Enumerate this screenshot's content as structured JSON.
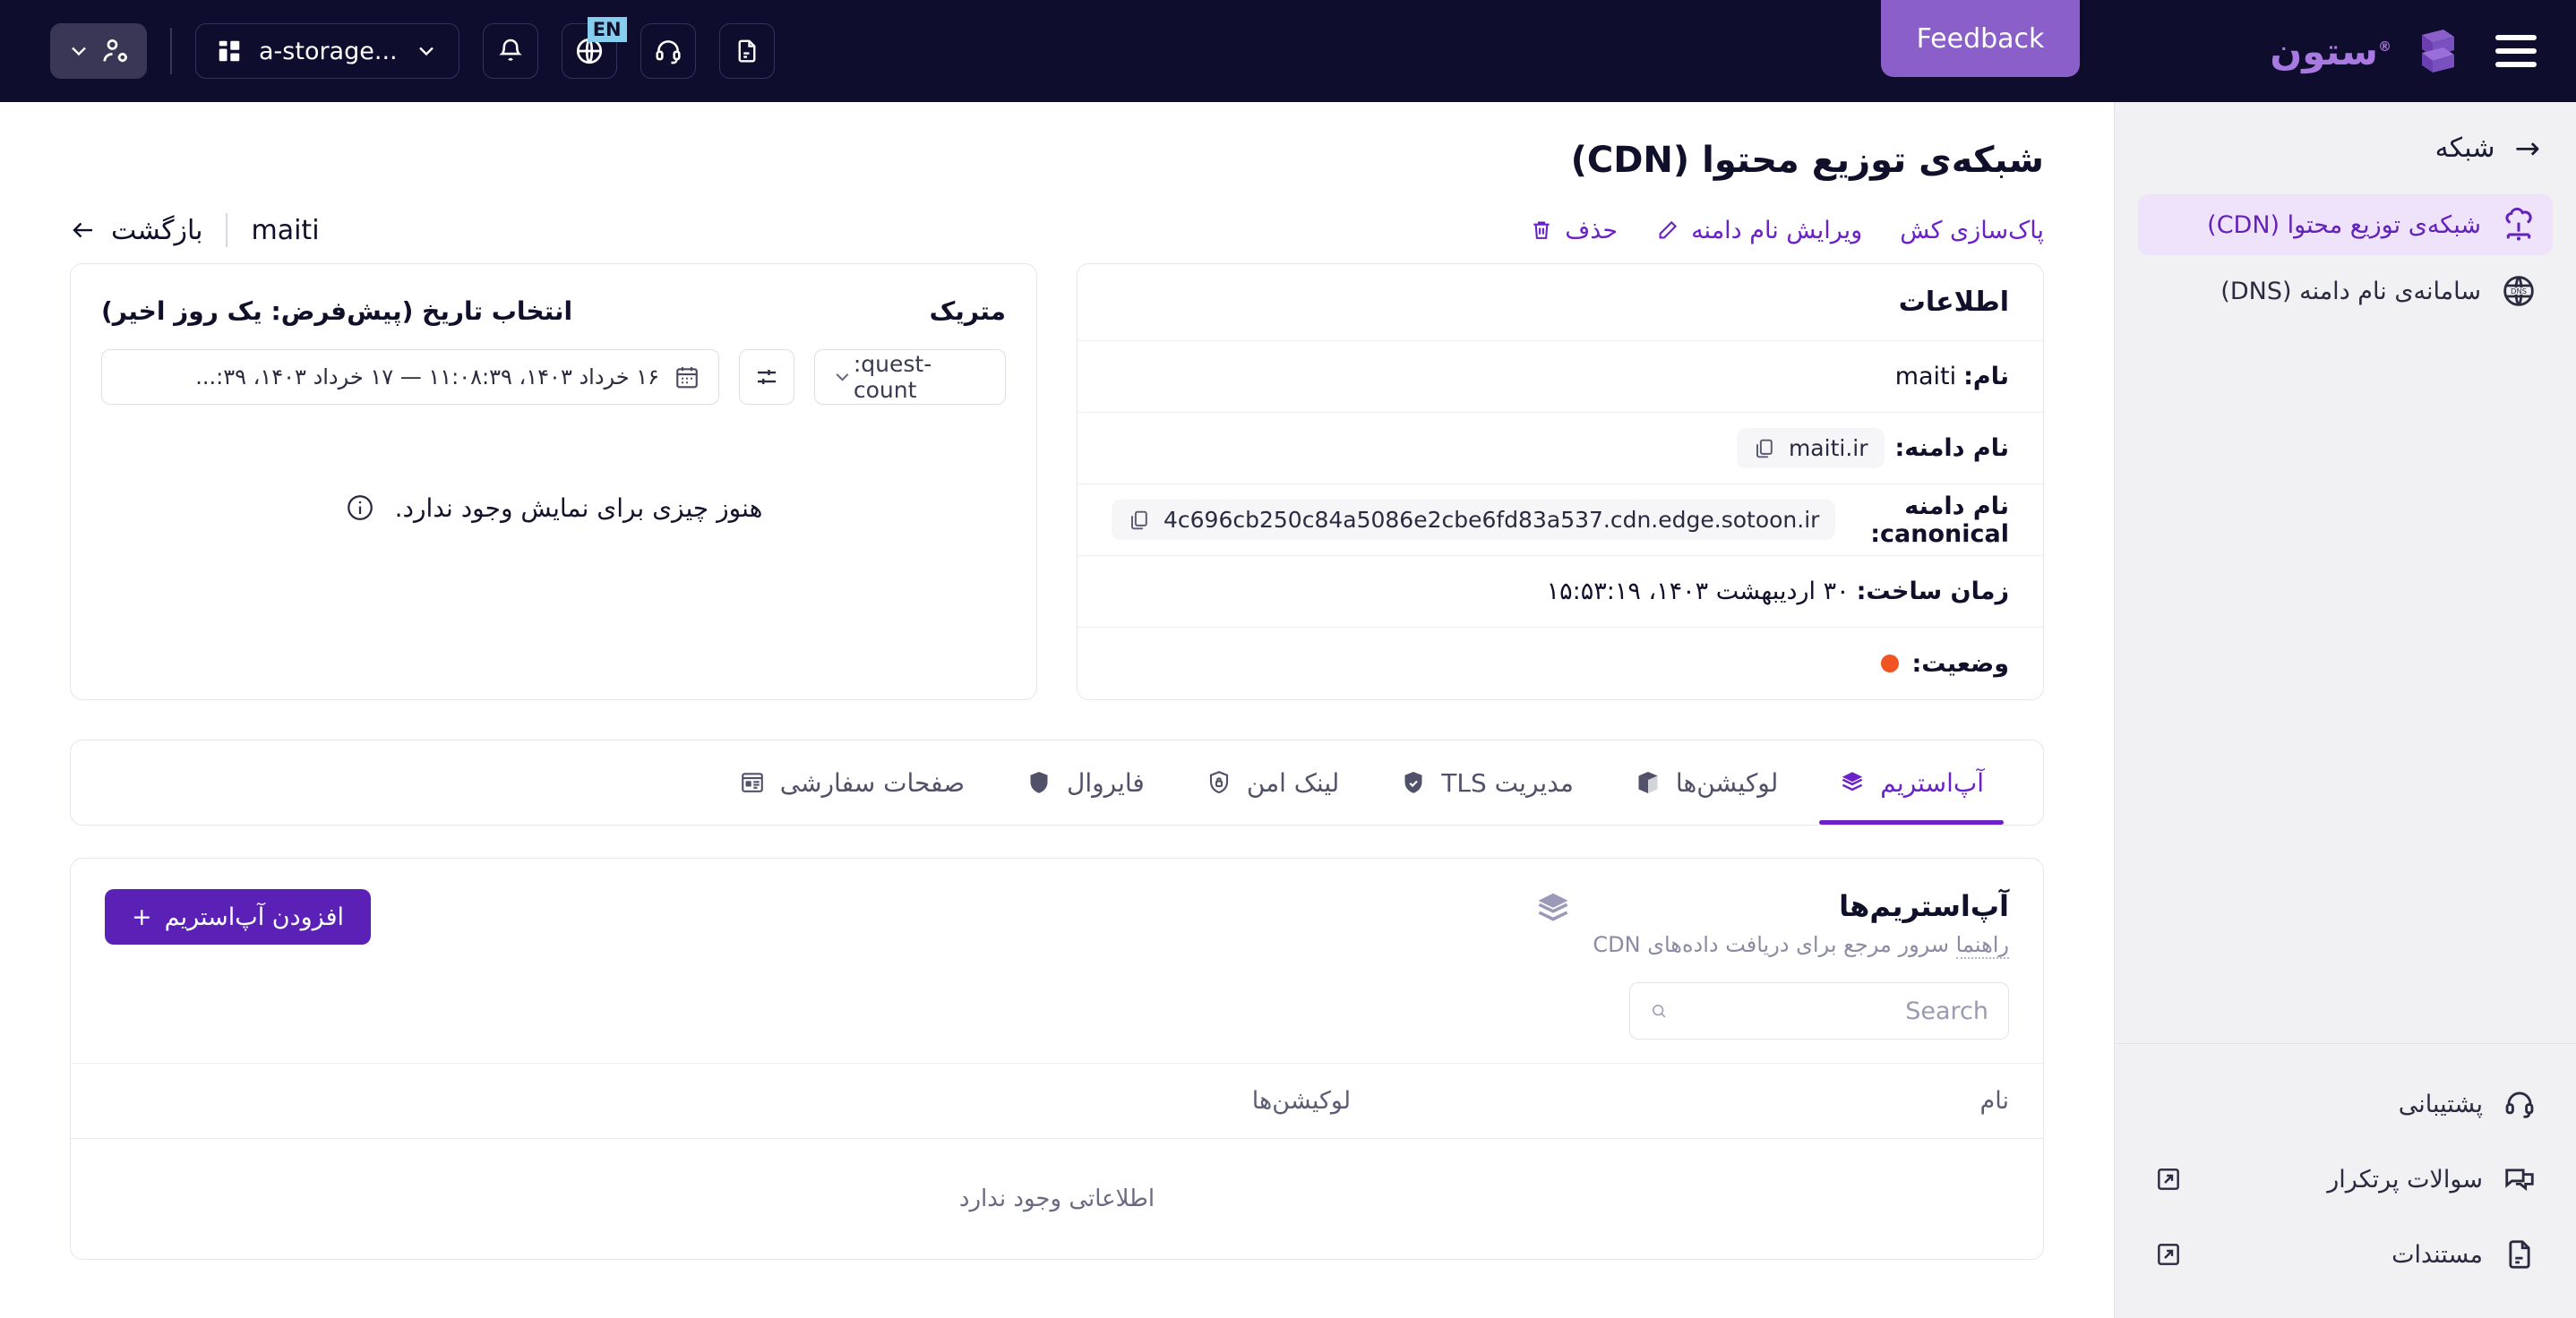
{
  "topbar": {
    "user_button": "user-settings",
    "project_selector": "...a-storage",
    "lang_badge": "EN",
    "feedback_label": "Feedback",
    "brand_name": "ستون",
    "brand_mark": "®"
  },
  "sidebar": {
    "header": "شبکه",
    "items": [
      {
        "label": "شبکه‌ی توزیع محتوا (CDN)",
        "icon": "cdn-cloud-icon",
        "active": true
      },
      {
        "label": "سامانه‌ی نام دامنه (DNS)",
        "icon": "dns-globe-icon",
        "active": false
      }
    ],
    "bottom_items": [
      {
        "label": "پشتیبانی",
        "icon": "headset-icon",
        "external": false
      },
      {
        "label": "سوالات پرتکرار",
        "icon": "chat-icon",
        "external": true
      },
      {
        "label": "مستندات",
        "icon": "document-icon",
        "external": true
      }
    ]
  },
  "page": {
    "title": "شبکه‌ی توزیع محتوا (CDN)",
    "back_label": "بازگشت",
    "resource_name": "maiti",
    "actions": [
      {
        "label": "پاک‌سازی کش",
        "icon": "none"
      },
      {
        "label": "ویرایش نام دامنه",
        "icon": "pencil-icon"
      },
      {
        "label": "حذف",
        "icon": "trash-icon"
      }
    ]
  },
  "info_card": {
    "title": "اطلاعات",
    "rows": [
      {
        "label": "نام:",
        "value": "maiti",
        "type": "text"
      },
      {
        "label": "نام دامنه:",
        "value": "maiti.ir",
        "type": "copy"
      },
      {
        "label": "نام دامنه canonical:",
        "value": "4c696cb250c84a5086e2cbe6fd83a537.cdn.edge.sotoon.ir",
        "type": "copy"
      },
      {
        "label": "زمان ساخت:",
        "value": "۳۰ اردیبهشت ۱۴۰۳، ۱۵:۵۳:۱۹",
        "type": "text"
      },
      {
        "label": "وضعیت:",
        "value": "",
        "type": "status",
        "status_color": "#f05423"
      }
    ]
  },
  "metric_card": {
    "title": "متریک",
    "date_section_label": "انتخاب تاریخ (پیش‌فرض: یک روز اخیر)",
    "date_range_value": "۱۶ خرداد ۱۴۰۳، ۱۱:۰۸:۳۹ — ۱۷ خرداد ۱۴۰۳، ۳۹:...",
    "metric_select_value": ":quest-count",
    "empty_message": "هنوز چیزی برای نمایش وجود ندارد."
  },
  "tabs": [
    {
      "label": "آپ‌استریم",
      "icon": "layers-icon",
      "active": true
    },
    {
      "label": "لوکیشن‌ها",
      "icon": "box-icon",
      "active": false
    },
    {
      "label": "مدیریت TLS",
      "icon": "shield-check-icon",
      "active": false
    },
    {
      "label": "لینک امن",
      "icon": "shield-lock-icon",
      "active": false
    },
    {
      "label": "فایروال",
      "icon": "shield-icon",
      "active": false
    },
    {
      "label": "صفحات سفارشی",
      "icon": "page-layout-icon",
      "active": false
    }
  ],
  "upstream_panel": {
    "title": "آپ‌استریم‌ها",
    "subtitle": "سرور مرجع برای دریافت داده‌های CDN",
    "guide_link": "راهنما",
    "add_button": "افزودن آپ‌استریم",
    "add_button_plus": "+",
    "search_placeholder": "Search",
    "search_value": "",
    "table": {
      "columns": [
        "نام",
        "لوکیشن‌ها"
      ],
      "rows": [],
      "empty_message": "اطلاعاتی وجود ندارد"
    }
  },
  "colors": {
    "topbar_bg": "#0f0d2e",
    "brand_purple": "#a879e0",
    "accent_purple": "#6b21c8",
    "button_purple": "#5b21b6",
    "feedback_purple": "#8b5fc9",
    "sidebar_bg": "#f1f1f3",
    "active_item_bg": "#eee3fb",
    "status_orange": "#f05423",
    "lang_badge_bg": "#86cdee"
  }
}
